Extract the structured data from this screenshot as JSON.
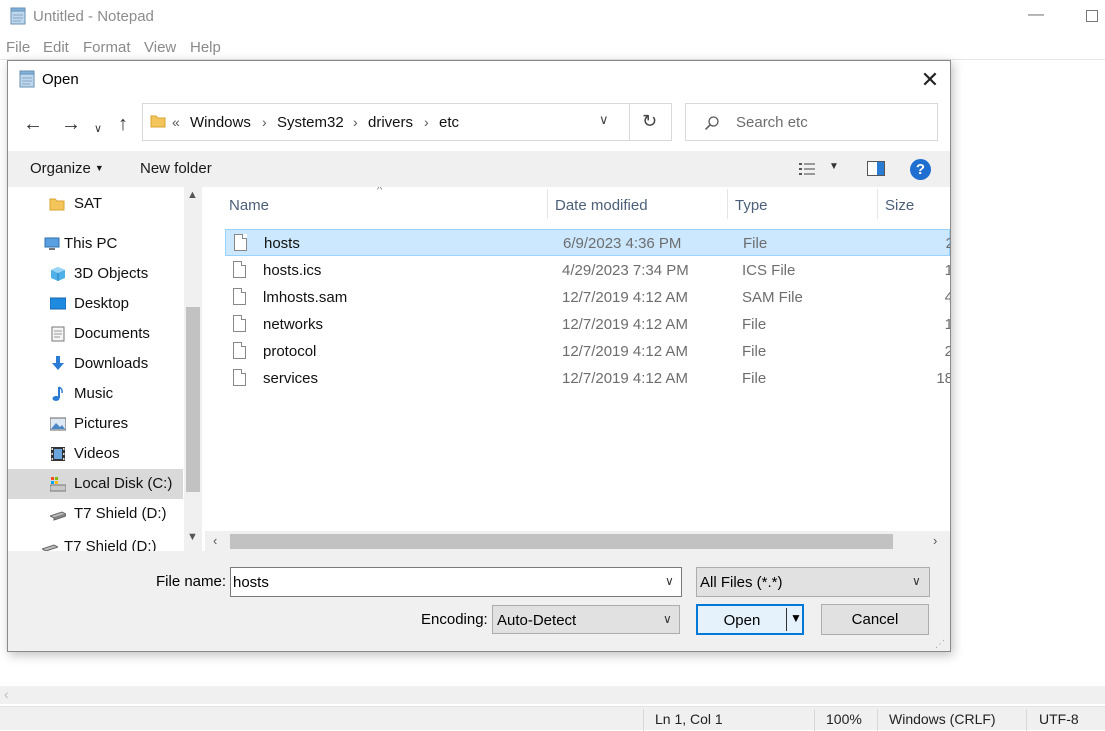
{
  "notepad": {
    "title": "Untitled - Notepad",
    "menu": [
      "File",
      "Edit",
      "Format",
      "View",
      "Help"
    ],
    "status": {
      "position": "Ln 1, Col 1",
      "zoom": "100%",
      "line_ending": "Windows (CRLF)",
      "encoding": "UTF-8"
    }
  },
  "dialog": {
    "title": "Open",
    "address": {
      "overflow": "«",
      "segments": [
        "Windows",
        "System32",
        "drivers",
        "etc"
      ]
    },
    "search_placeholder": "Search etc",
    "commands": {
      "organize": "Organize",
      "new_folder": "New folder"
    },
    "tree": [
      {
        "label": "SAT",
        "icon": "folder-icon",
        "selected": false
      },
      {
        "label": "This PC",
        "icon": "computer-icon",
        "selected": false
      },
      {
        "label": "3D Objects",
        "icon": "cube-icon",
        "selected": false
      },
      {
        "label": "Desktop",
        "icon": "desktop-icon",
        "selected": false
      },
      {
        "label": "Documents",
        "icon": "document-icon",
        "selected": false
      },
      {
        "label": "Downloads",
        "icon": "download-icon",
        "selected": false
      },
      {
        "label": "Music",
        "icon": "music-icon",
        "selected": false
      },
      {
        "label": "Pictures",
        "icon": "pictures-icon",
        "selected": false
      },
      {
        "label": "Videos",
        "icon": "video-icon",
        "selected": false
      },
      {
        "label": "Local Disk (C:)",
        "icon": "drive-icon",
        "selected": true
      },
      {
        "label": "T7 Shield (D:)",
        "icon": "usb-drive-icon",
        "selected": false
      },
      {
        "label": "T7 Shield (D:)",
        "icon": "usb-drive-icon",
        "selected": false
      }
    ],
    "columns": [
      "Name",
      "Date modified",
      "Type",
      "Size"
    ],
    "files": [
      {
        "name": "hosts",
        "date": "6/9/2023 4:36 PM",
        "type": "File",
        "size": "2",
        "selected": true
      },
      {
        "name": "hosts.ics",
        "date": "4/29/2023 7:34 PM",
        "type": "ICS File",
        "size": "1",
        "selected": false
      },
      {
        "name": "lmhosts.sam",
        "date": "12/7/2019 4:12 AM",
        "type": "SAM File",
        "size": "4",
        "selected": false
      },
      {
        "name": "networks",
        "date": "12/7/2019 4:12 AM",
        "type": "File",
        "size": "1",
        "selected": false
      },
      {
        "name": "protocol",
        "date": "12/7/2019 4:12 AM",
        "type": "File",
        "size": "2",
        "selected": false
      },
      {
        "name": "services",
        "date": "12/7/2019 4:12 AM",
        "type": "File",
        "size": "18",
        "selected": false
      }
    ],
    "file_name_label": "File name:",
    "file_name_value": "hosts",
    "file_type_filter": "All Files  (*.*)",
    "encoding_label": "Encoding:",
    "encoding_value": "Auto-Detect",
    "open_label": "Open",
    "cancel_label": "Cancel"
  },
  "colors": {
    "selection_bg": "#cce8ff",
    "selection_border": "#99d1ff",
    "primary_button_border": "#0078d7",
    "help_icon": "#1e6fd0"
  }
}
